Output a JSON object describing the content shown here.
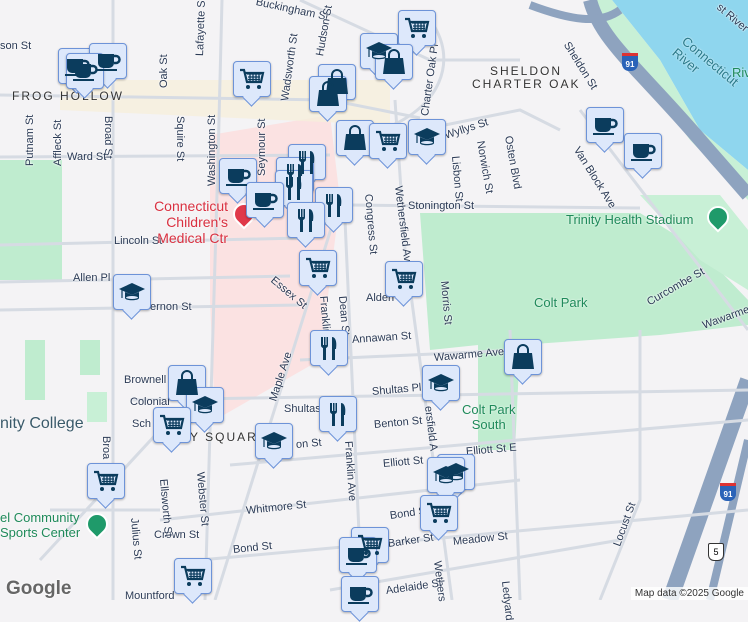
{
  "neighborhoods": {
    "frog_hollow": "FROG HOLLOW",
    "sheldon": "SHELDON",
    "charter_oak": "CHARTER OAK",
    "square": "Y SQUARE"
  },
  "streets": {
    "buckingham": "Buckingham St",
    "hudson": "Hudson St",
    "lafayette": "Lafayette St",
    "wadsworth": "Wadsworth St",
    "oak": "Oak St",
    "madison": "son St",
    "putnam": "Putnam St",
    "affleck": "Affleck St",
    "broad": "Broad St",
    "squire": "Squire St",
    "washington": "Washington St",
    "seymour": "Seymour St",
    "ward": "Ward St",
    "lincoln": "Lincoln St",
    "allen": "Allen Pl",
    "vernon": "ernon St",
    "essex": "Essex St",
    "congress": "Congress St",
    "dean": "Dean St",
    "franklin": "Franklin Ave",
    "franklin2": "Franklin Ave",
    "maple": "Maple Ave",
    "wethersfield": "Wethersfield Ave",
    "wethersfield2": "ersfield A",
    "wethersfield3": "Wethers",
    "charter_oak_pl": "Charter Oak Pl",
    "wyllys": "Wyllys St",
    "lisbon": "Lisbon St",
    "norwich": "Norwich St",
    "osten": "Osten Blvd",
    "sheldon_st": "Sheldon St",
    "van_block": "Van Block Ave",
    "stonington": "Stonington St",
    "morris": "Morris St",
    "alden": "Alden",
    "curcombe": "Curcombe St",
    "wawarme": "Wawarme",
    "wawarme_ave": "Wawarme Ave",
    "annawan": "Annawan St",
    "brownell": "Brownell",
    "colonial": "Colonial",
    "shultas": "Shultas",
    "shultas_pl": "Shultas Pl",
    "benton": "Benton St",
    "elliott": "Elliott St",
    "elliott_e": "Elliott St E",
    "whitmore": "Whitmore St",
    "bond": "Bond St",
    "bond2": "Bond St",
    "barker": "Barker St",
    "meadow": "Meadow St",
    "adelaide": "Adelaide St",
    "ledyard": "Ledyard",
    "locust": "Locust St",
    "crown": "Crown St",
    "ellsworth": "Ellsworth St",
    "julius": "Julius St",
    "webster": "Webster St",
    "mountford": "Mountford",
    "broad2": "Broa",
    "schol": "Sch",
    "orton": "on St"
  },
  "pois": {
    "hospital_line1": "Connecticut",
    "hospital_line2": "Children's Medical Ctr",
    "stadium": "Trinity Health Stadium",
    "colt_park": "Colt Park",
    "colt_park_south_1": "Colt Park",
    "colt_park_south_2": "South",
    "community_1": "el Community",
    "community_2": "Sports Center",
    "college": "nity College",
    "river": "Connecticut River",
    "river2": "Riv",
    "east_river": "st River"
  },
  "highways": {
    "i91": "91",
    "i91b": "91",
    "us5": "5"
  },
  "markers": [
    "coffee",
    "coffee",
    "shopping-cart",
    "graduation-cap",
    "shopping-cart",
    "shopping-bag",
    "shopping-bag",
    "shopping-bag",
    "shopping-cart",
    "graduation-cap",
    "coffee",
    "coffee",
    "coffee",
    "coffee",
    "restaurant",
    "restaurant",
    "restaurant",
    "restaurant",
    "restaurant",
    "shopping-cart",
    "shopping-cart",
    "graduation-cap",
    "restaurant",
    "restaurant",
    "shopping-bag",
    "graduation-cap",
    "shopping-cart",
    "graduation-cap",
    "shopping-cart",
    "shopping-bag",
    "graduation-cap",
    "graduation-cap",
    "shopping-cart",
    "coffee",
    "coffee",
    "shopping-cart"
  ],
  "attribution": {
    "logo": "Google",
    "map_data": "Map data ©2025 Google"
  },
  "colors": {
    "marker_bg": "#dde8fb",
    "marker_border": "#6d93d8",
    "icon": "#0b3c5d",
    "park": "#bfeccf",
    "water": "#8fd6ee",
    "highway": "#8ea3bf"
  }
}
